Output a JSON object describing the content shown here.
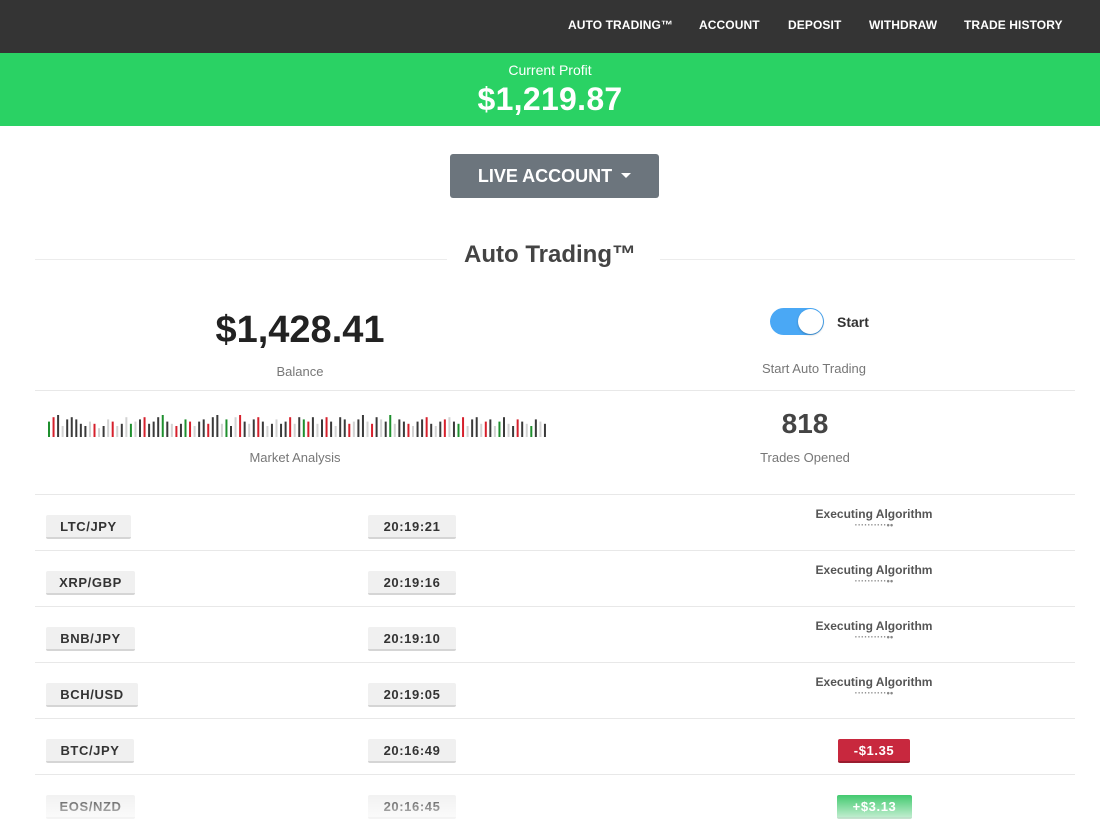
{
  "nav": {
    "items": [
      "AUTO TRADING™",
      "ACCOUNT",
      "DEPOSIT",
      "WITHDRAW",
      "TRADE HISTORY"
    ]
  },
  "profit": {
    "label": "Current Profit",
    "value": "$1,219.87"
  },
  "account_button": {
    "label": "LIVE ACCOUNT",
    "icon": "caret-down-icon"
  },
  "section": {
    "title": "Auto Trading™"
  },
  "balance": {
    "value": "$1,428.41",
    "label": "Balance"
  },
  "auto_trading": {
    "toggle_label": "Start",
    "toggle_on": true,
    "label": "Start Auto Trading"
  },
  "market": {
    "label": "Market Analysis",
    "bars": [
      [
        "g",
        0.7
      ],
      [
        "r",
        0.9
      ],
      [
        "d",
        1.0
      ],
      [
        "l",
        0.5
      ],
      [
        "d",
        0.8
      ],
      [
        "d",
        0.9
      ],
      [
        "d",
        0.8
      ],
      [
        "d",
        0.6
      ],
      [
        "d",
        0.5
      ],
      [
        "l",
        0.7
      ],
      [
        "r",
        0.6
      ],
      [
        "l",
        0.4
      ],
      [
        "d",
        0.5
      ],
      [
        "l",
        0.8
      ],
      [
        "r",
        0.7
      ],
      [
        "l",
        0.5
      ],
      [
        "d",
        0.6
      ],
      [
        "l",
        0.9
      ],
      [
        "g",
        0.6
      ],
      [
        "l",
        0.7
      ],
      [
        "d",
        0.8
      ],
      [
        "r",
        0.9
      ],
      [
        "d",
        0.6
      ],
      [
        "d",
        0.7
      ],
      [
        "d",
        0.9
      ],
      [
        "g",
        1.0
      ],
      [
        "d",
        0.7
      ],
      [
        "l",
        0.6
      ],
      [
        "r",
        0.5
      ],
      [
        "d",
        0.6
      ],
      [
        "g",
        0.8
      ],
      [
        "r",
        0.7
      ],
      [
        "l",
        0.5
      ],
      [
        "d",
        0.7
      ],
      [
        "d",
        0.8
      ],
      [
        "r",
        0.6
      ],
      [
        "d",
        0.9
      ],
      [
        "d",
        1.0
      ],
      [
        "l",
        0.6
      ],
      [
        "g",
        0.8
      ],
      [
        "d",
        0.5
      ],
      [
        "l",
        0.9
      ],
      [
        "r",
        1.0
      ],
      [
        "d",
        0.7
      ],
      [
        "l",
        0.6
      ],
      [
        "d",
        0.8
      ],
      [
        "r",
        0.9
      ],
      [
        "d",
        0.7
      ],
      [
        "l",
        0.5
      ],
      [
        "d",
        0.6
      ],
      [
        "l",
        0.8
      ],
      [
        "d",
        0.6
      ],
      [
        "d",
        0.7
      ],
      [
        "r",
        0.9
      ],
      [
        "l",
        0.6
      ],
      [
        "d",
        0.9
      ],
      [
        "g",
        0.8
      ],
      [
        "r",
        0.7
      ],
      [
        "d",
        0.9
      ],
      [
        "l",
        0.6
      ],
      [
        "d",
        0.8
      ],
      [
        "r",
        0.9
      ],
      [
        "d",
        0.7
      ],
      [
        "l",
        0.5
      ],
      [
        "d",
        0.9
      ],
      [
        "d",
        0.8
      ],
      [
        "r",
        0.6
      ],
      [
        "l",
        0.7
      ],
      [
        "d",
        0.8
      ],
      [
        "d",
        1.0
      ],
      [
        "l",
        0.7
      ],
      [
        "r",
        0.6
      ],
      [
        "d",
        0.9
      ],
      [
        "l",
        0.8
      ],
      [
        "d",
        0.7
      ],
      [
        "g",
        1.0
      ],
      [
        "l",
        0.6
      ],
      [
        "d",
        0.8
      ],
      [
        "d",
        0.7
      ],
      [
        "r",
        0.6
      ],
      [
        "l",
        0.5
      ],
      [
        "d",
        0.7
      ],
      [
        "d",
        0.8
      ],
      [
        "r",
        0.9
      ],
      [
        "d",
        0.6
      ],
      [
        "l",
        0.5
      ],
      [
        "d",
        0.7
      ],
      [
        "r",
        0.8
      ],
      [
        "l",
        0.9
      ],
      [
        "d",
        0.7
      ],
      [
        "g",
        0.6
      ],
      [
        "r",
        0.9
      ],
      [
        "l",
        0.5
      ],
      [
        "d",
        0.8
      ],
      [
        "d",
        0.9
      ],
      [
        "l",
        0.6
      ],
      [
        "r",
        0.7
      ],
      [
        "d",
        0.8
      ],
      [
        "l",
        0.5
      ],
      [
        "g",
        0.7
      ],
      [
        "d",
        0.9
      ],
      [
        "l",
        0.6
      ],
      [
        "d",
        0.5
      ],
      [
        "r",
        0.8
      ],
      [
        "d",
        0.7
      ],
      [
        "l",
        0.6
      ],
      [
        "g",
        0.5
      ],
      [
        "d",
        0.8
      ],
      [
        "l",
        0.7
      ],
      [
        "d",
        0.6
      ]
    ]
  },
  "trades": {
    "value": "818",
    "label": "Trades Opened"
  },
  "rows": [
    {
      "pair": "LTC/JPY",
      "time": "20:19:21",
      "status": "executing",
      "status_text": "Executing Algorithm",
      "dots": "··········••"
    },
    {
      "pair": "XRP/GBP",
      "time": "20:19:16",
      "status": "executing",
      "status_text": "Executing Algorithm",
      "dots": "··········••"
    },
    {
      "pair": "BNB/JPY",
      "time": "20:19:10",
      "status": "executing",
      "status_text": "Executing Algorithm",
      "dots": "··········••"
    },
    {
      "pair": "BCH/USD",
      "time": "20:19:05",
      "status": "executing",
      "status_text": "Executing Algorithm",
      "dots": "··········••"
    },
    {
      "pair": "BTC/JPY",
      "time": "20:16:49",
      "status": "loss",
      "result": "-$1.35"
    },
    {
      "pair": "EOS/NZD",
      "time": "20:16:45",
      "status": "profit",
      "result": "+$3.13"
    }
  ],
  "colors": {
    "nav_bg": "#343434",
    "profit_bg": "#2ad264",
    "button_bg": "#6c757d",
    "toggle_on": "#4aa8f5",
    "loss": "#c8283e",
    "profit": "#27c25a",
    "bar_green": "#1e8f2e",
    "bar_red": "#d6202c",
    "bar_dark": "#3a3a3a",
    "bar_light": "#d2d2d2"
  }
}
